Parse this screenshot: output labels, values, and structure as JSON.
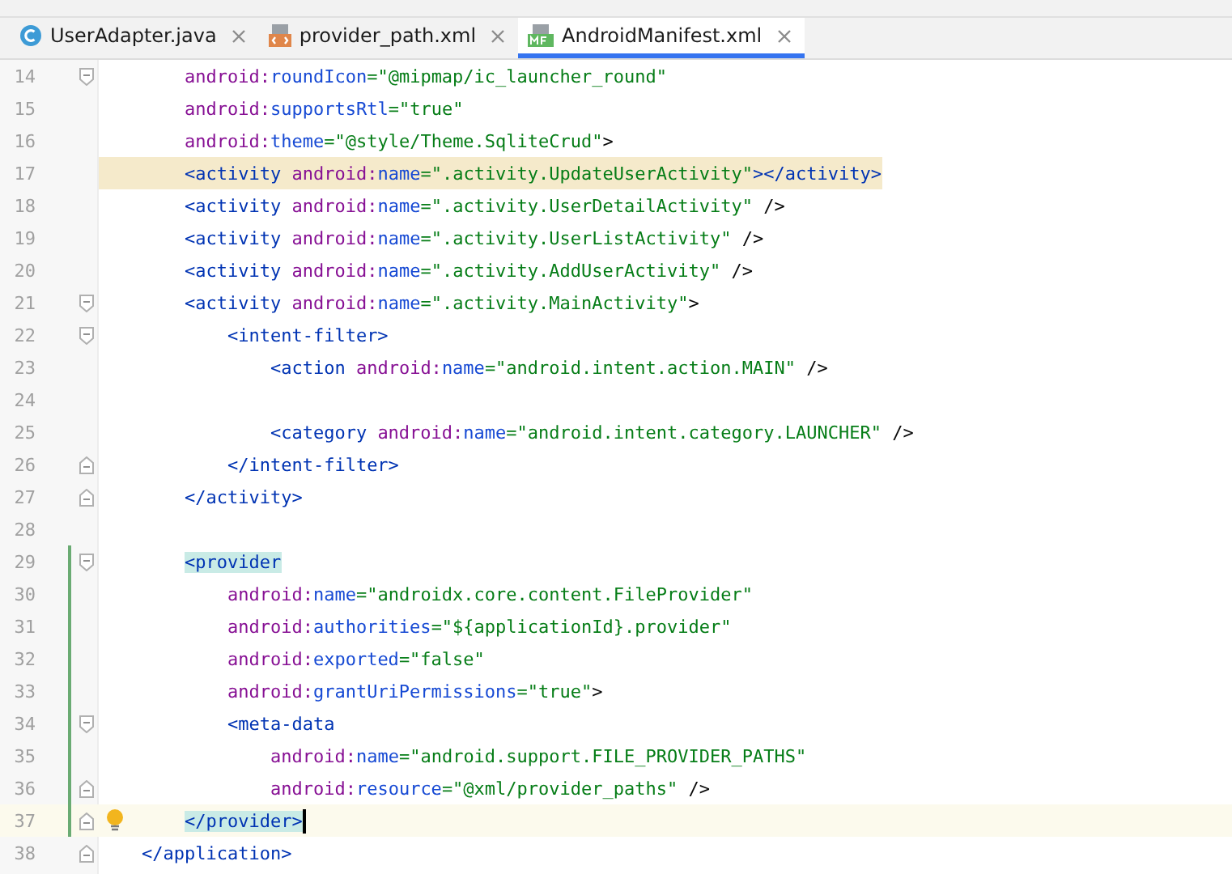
{
  "tabs": [
    {
      "label": "UserAdapter.java",
      "kind": "class",
      "selected": false
    },
    {
      "label": "provider_path.xml",
      "kind": "xml",
      "selected": false
    },
    {
      "label": "AndroidManifest.xml",
      "kind": "manifest",
      "selected": true
    }
  ],
  "editor": {
    "lines": [
      {
        "number": "14",
        "fold_start": true,
        "fold_end": false,
        "search_match": false,
        "current": false,
        "changed": false,
        "bulb": false,
        "caret": false,
        "tokens": [
          {
            "kind": "ns",
            "t": "        android:"
          },
          {
            "kind": "attr",
            "t": "roundIcon"
          },
          {
            "kind": "value",
            "t": "=\"@mipmap/ic_launcher_round\""
          }
        ]
      },
      {
        "number": "15",
        "fold_start": false,
        "fold_end": false,
        "search_match": false,
        "current": false,
        "changed": false,
        "bulb": false,
        "caret": false,
        "tokens": [
          {
            "kind": "ns",
            "t": "        android:"
          },
          {
            "kind": "attr",
            "t": "supportsRtl"
          },
          {
            "kind": "value",
            "t": "=\"true\""
          }
        ]
      },
      {
        "number": "16",
        "fold_start": false,
        "fold_end": false,
        "search_match": false,
        "current": false,
        "changed": false,
        "bulb": false,
        "caret": false,
        "tokens": [
          {
            "kind": "ns",
            "t": "        android:"
          },
          {
            "kind": "attr",
            "t": "theme"
          },
          {
            "kind": "value",
            "t": "=\"@style/Theme.SqliteCrud\""
          },
          {
            "kind": "punct",
            "t": ">"
          }
        ]
      },
      {
        "number": "17",
        "fold_start": false,
        "fold_end": false,
        "search_match": true,
        "current": false,
        "changed": false,
        "bulb": false,
        "caret": false,
        "tokens": [
          {
            "kind": "tag",
            "t": "        <activity "
          },
          {
            "kind": "ns",
            "t": "android:"
          },
          {
            "kind": "attr",
            "t": "name"
          },
          {
            "kind": "value",
            "t": "=\".activity.UpdateUserActivity\""
          },
          {
            "kind": "tag",
            "t": "></activity>"
          }
        ]
      },
      {
        "number": "18",
        "fold_start": false,
        "fold_end": false,
        "search_match": false,
        "current": false,
        "changed": false,
        "bulb": false,
        "caret": false,
        "tokens": [
          {
            "kind": "tag",
            "t": "        <activity "
          },
          {
            "kind": "ns",
            "t": "android:"
          },
          {
            "kind": "attr",
            "t": "name"
          },
          {
            "kind": "value",
            "t": "=\".activity.UserDetailActivity\""
          },
          {
            "kind": "punct",
            "t": " />"
          }
        ]
      },
      {
        "number": "19",
        "fold_start": false,
        "fold_end": false,
        "search_match": false,
        "current": false,
        "changed": false,
        "bulb": false,
        "caret": false,
        "tokens": [
          {
            "kind": "tag",
            "t": "        <activity "
          },
          {
            "kind": "ns",
            "t": "android:"
          },
          {
            "kind": "attr",
            "t": "name"
          },
          {
            "kind": "value",
            "t": "=\".activity.UserListActivity\""
          },
          {
            "kind": "punct",
            "t": " />"
          }
        ]
      },
      {
        "number": "20",
        "fold_start": false,
        "fold_end": false,
        "search_match": false,
        "current": false,
        "changed": false,
        "bulb": false,
        "caret": false,
        "tokens": [
          {
            "kind": "tag",
            "t": "        <activity "
          },
          {
            "kind": "ns",
            "t": "android:"
          },
          {
            "kind": "attr",
            "t": "name"
          },
          {
            "kind": "value",
            "t": "=\".activity.AddUserActivity\""
          },
          {
            "kind": "punct",
            "t": " />"
          }
        ]
      },
      {
        "number": "21",
        "fold_start": true,
        "fold_end": false,
        "search_match": false,
        "current": false,
        "changed": false,
        "bulb": false,
        "caret": false,
        "tokens": [
          {
            "kind": "tag",
            "t": "        <activity "
          },
          {
            "kind": "ns",
            "t": "android:"
          },
          {
            "kind": "attr",
            "t": "name"
          },
          {
            "kind": "value",
            "t": "=\".activity.MainActivity\""
          },
          {
            "kind": "punct",
            "t": ">"
          }
        ]
      },
      {
        "number": "22",
        "fold_start": true,
        "fold_end": false,
        "search_match": false,
        "current": false,
        "changed": false,
        "bulb": false,
        "caret": false,
        "tokens": [
          {
            "kind": "tag",
            "t": "            <intent-filter>"
          }
        ]
      },
      {
        "number": "23",
        "fold_start": false,
        "fold_end": false,
        "search_match": false,
        "current": false,
        "changed": false,
        "bulb": false,
        "caret": false,
        "tokens": [
          {
            "kind": "tag",
            "t": "                <action "
          },
          {
            "kind": "ns",
            "t": "android:"
          },
          {
            "kind": "attr",
            "t": "name"
          },
          {
            "kind": "value",
            "t": "=\"android.intent.action.MAIN\""
          },
          {
            "kind": "punct",
            "t": " />"
          }
        ]
      },
      {
        "number": "24",
        "fold_start": false,
        "fold_end": false,
        "search_match": false,
        "current": false,
        "changed": false,
        "bulb": false,
        "caret": false
      },
      {
        "number": "25",
        "fold_start": false,
        "fold_end": false,
        "search_match": false,
        "current": false,
        "changed": false,
        "bulb": false,
        "caret": false,
        "tokens": [
          {
            "kind": "tag",
            "t": "                <category "
          },
          {
            "kind": "ns",
            "t": "android:"
          },
          {
            "kind": "attr",
            "t": "name"
          },
          {
            "kind": "value",
            "t": "=\"android.intent.category.LAUNCHER\""
          },
          {
            "kind": "punct",
            "t": " />"
          }
        ]
      },
      {
        "number": "26",
        "fold_start": false,
        "fold_end": true,
        "search_match": false,
        "current": false,
        "changed": false,
        "bulb": false,
        "caret": false,
        "tokens": [
          {
            "kind": "tag",
            "t": "            </intent-filter>"
          }
        ]
      },
      {
        "number": "27",
        "fold_start": false,
        "fold_end": true,
        "search_match": false,
        "current": false,
        "changed": false,
        "bulb": false,
        "caret": false,
        "tokens": [
          {
            "kind": "tag",
            "t": "        </activity>"
          }
        ]
      },
      {
        "number": "28",
        "fold_start": false,
        "fold_end": false,
        "search_match": false,
        "current": false,
        "changed": false,
        "bulb": false,
        "caret": false
      },
      {
        "number": "29",
        "fold_start": true,
        "fold_end": false,
        "search_match": false,
        "current": false,
        "changed": true,
        "bulb": false,
        "caret": false,
        "tokens": [
          {
            "kind": "match",
            "t": "        <provider"
          }
        ]
      },
      {
        "number": "30",
        "fold_start": false,
        "fold_end": false,
        "search_match": false,
        "current": false,
        "changed": true,
        "bulb": false,
        "caret": false,
        "tokens": [
          {
            "kind": "ns",
            "t": "            android:"
          },
          {
            "kind": "attr",
            "t": "name"
          },
          {
            "kind": "value",
            "t": "=\"androidx.core.content.FileProvider\""
          }
        ]
      },
      {
        "number": "31",
        "fold_start": false,
        "fold_end": false,
        "search_match": false,
        "current": false,
        "changed": true,
        "bulb": false,
        "caret": false,
        "tokens": [
          {
            "kind": "ns",
            "t": "            android:"
          },
          {
            "kind": "attr",
            "t": "authorities"
          },
          {
            "kind": "value",
            "t": "=\"${applicationId}.provider\""
          }
        ]
      },
      {
        "number": "32",
        "fold_start": false,
        "fold_end": false,
        "search_match": false,
        "current": false,
        "changed": true,
        "bulb": false,
        "caret": false,
        "tokens": [
          {
            "kind": "ns",
            "t": "            android:"
          },
          {
            "kind": "attr",
            "t": "exported"
          },
          {
            "kind": "value",
            "t": "=\"false\""
          }
        ]
      },
      {
        "number": "33",
        "fold_start": false,
        "fold_end": false,
        "search_match": false,
        "current": false,
        "changed": true,
        "bulb": false,
        "caret": false,
        "tokens": [
          {
            "kind": "ns",
            "t": "            android:"
          },
          {
            "kind": "attr",
            "t": "grantUriPermissions"
          },
          {
            "kind": "value",
            "t": "=\"true\""
          },
          {
            "kind": "punct",
            "t": ">"
          }
        ]
      },
      {
        "number": "34",
        "fold_start": true,
        "fold_end": false,
        "search_match": false,
        "current": false,
        "changed": true,
        "bulb": false,
        "caret": false,
        "tokens": [
          {
            "kind": "tag",
            "t": "            <meta-data"
          }
        ]
      },
      {
        "number": "35",
        "fold_start": false,
        "fold_end": false,
        "search_match": false,
        "current": false,
        "changed": true,
        "bulb": false,
        "caret": false,
        "tokens": [
          {
            "kind": "ns",
            "t": "                android:"
          },
          {
            "kind": "attr",
            "t": "name"
          },
          {
            "kind": "value",
            "t": "=\"android.support.FILE_PROVIDER_PATHS\""
          }
        ]
      },
      {
        "number": "36",
        "fold_start": false,
        "fold_end": true,
        "search_match": false,
        "current": false,
        "changed": true,
        "bulb": false,
        "caret": false,
        "tokens": [
          {
            "kind": "ns",
            "t": "                android:"
          },
          {
            "kind": "attr",
            "t": "resource"
          },
          {
            "kind": "value",
            "t": "=\"@xml/provider_paths\""
          },
          {
            "kind": "punct",
            "t": " />"
          }
        ]
      },
      {
        "number": "37",
        "fold_start": false,
        "fold_end": true,
        "search_match": false,
        "current": true,
        "changed": true,
        "bulb": true,
        "caret": true,
        "tokens": [
          {
            "kind": "match",
            "t": "        </provider>"
          }
        ]
      },
      {
        "number": "38",
        "fold_start": false,
        "fold_end": true,
        "search_match": false,
        "current": false,
        "changed": false,
        "bulb": false,
        "caret": false,
        "tokens": [
          {
            "kind": "tag",
            "t": "    </application>"
          }
        ]
      }
    ]
  }
}
